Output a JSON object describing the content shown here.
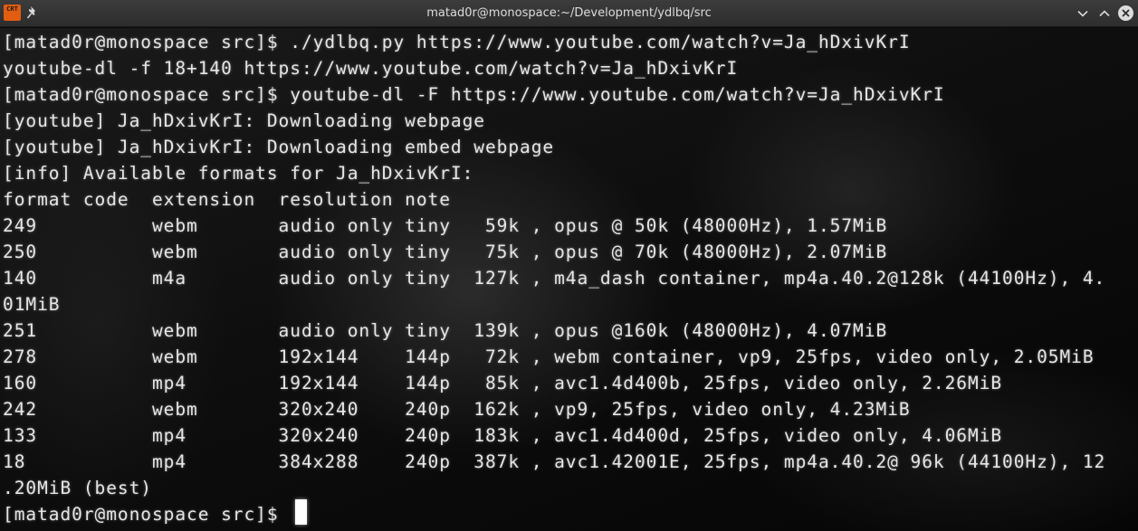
{
  "window": {
    "title": "matad0r@monospace:~/Development/ydlbq/src",
    "app_icon_text": "CRT",
    "icons": [
      "crt-app-icon",
      "pin-icon",
      "chevron-down-icon",
      "chevron-up-icon",
      "close-icon"
    ]
  },
  "terminal": {
    "lines": [
      "[matad0r@monospace src]$ ./ydlbq.py https://www.youtube.com/watch?v=Ja_hDxivKrI",
      "youtube-dl -f 18+140 https://www.youtube.com/watch?v=Ja_hDxivKrI",
      "[matad0r@monospace src]$ youtube-dl -F https://www.youtube.com/watch?v=Ja_hDxivKrI",
      "[youtube] Ja_hDxivKrI: Downloading webpage",
      "[youtube] Ja_hDxivKrI: Downloading embed webpage",
      "[info] Available formats for Ja_hDxivKrI:",
      "format code  extension  resolution note",
      "249          webm       audio only tiny   59k , opus @ 50k (48000Hz), 1.57MiB",
      "250          webm       audio only tiny   75k , opus @ 70k (48000Hz), 2.07MiB",
      "140          m4a        audio only tiny  127k , m4a_dash container, mp4a.40.2@128k (44100Hz), 4.",
      "01MiB",
      "251          webm       audio only tiny  139k , opus @160k (48000Hz), 4.07MiB",
      "278          webm       192x144    144p   72k , webm container, vp9, 25fps, video only, 2.05MiB",
      "160          mp4        192x144    144p   85k , avc1.4d400b, 25fps, video only, 2.26MiB",
      "242          webm       320x240    240p  162k , vp9, 25fps, video only, 4.23MiB",
      "133          mp4        320x240    240p  183k , avc1.4d400d, 25fps, video only, 4.06MiB",
      "18           mp4        384x288    240p  387k , avc1.42001E, 25fps, mp4a.40.2@ 96k (44100Hz), 12",
      ".20MiB (best)",
      "[matad0r@monospace src]$ "
    ]
  },
  "colors": {
    "text": "#e6e6e6",
    "background": "#0a0a0a",
    "titlebar": "#333333",
    "app_icon": "#e25d10"
  }
}
